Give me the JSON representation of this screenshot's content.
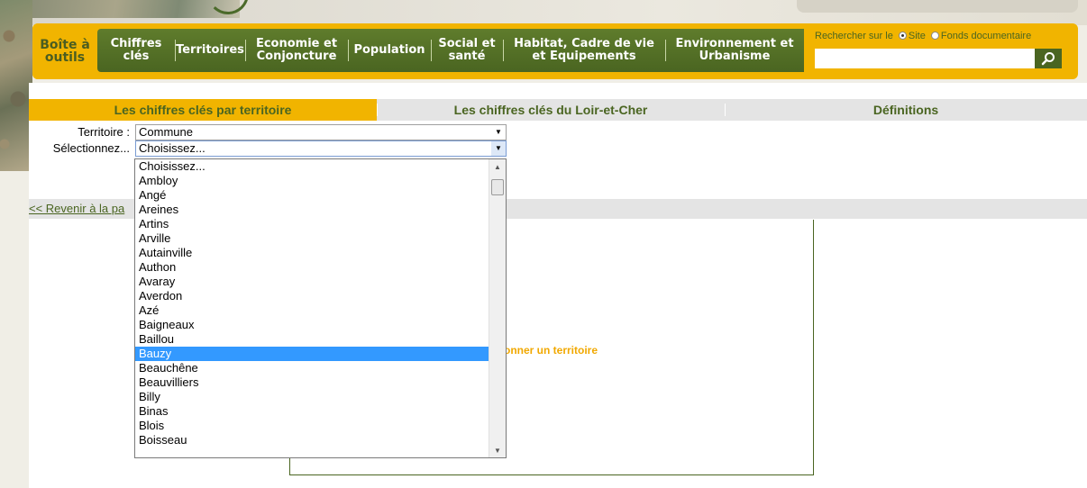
{
  "nav": {
    "home_label": "Boîte à outils",
    "items": [
      {
        "label": "Chiffres clés"
      },
      {
        "label": "Territoires"
      },
      {
        "label": "Economie et Conjoncture"
      },
      {
        "label": "Population"
      },
      {
        "label": "Social et santé"
      },
      {
        "label": "Habitat, Cadre de vie et Equipements"
      },
      {
        "label": "Environnement et Urbanisme"
      }
    ]
  },
  "search": {
    "label_prefix": "Rechercher sur le",
    "option_site": "Site",
    "option_fonds": "Fonds documentaire",
    "selected": "Site",
    "value": ""
  },
  "tabs": [
    {
      "label": "Les chiffres clés par territoire",
      "active": true
    },
    {
      "label": "Les chiffres clés du Loir-et-Cher",
      "active": false
    },
    {
      "label": "Définitions",
      "active": false
    }
  ],
  "form": {
    "territoire_label": "Territoire :",
    "territoire_value": "Commune",
    "selection_label": "Sélectionnez...",
    "selection_value": "Choisissez..."
  },
  "back_link": "<< Revenir à la pa",
  "result_message": "ctionner un territoire",
  "dropdown": {
    "options": [
      "Choisissez...",
      "Ambloy",
      "Angé",
      "Areines",
      "Artins",
      "Arville",
      "Autainville",
      "Authon",
      "Avaray",
      "Averdon",
      "Azé",
      "Baigneaux",
      "Baillou",
      "Bauzy",
      "Beauchêne",
      "Beauvilliers",
      "Billy",
      "Binas",
      "Blois",
      "Boisseau"
    ],
    "highlighted": "Bauzy"
  },
  "colors": {
    "accent_yellow": "#f1b400",
    "nav_green": "#4a6521",
    "highlight_blue": "#3399ff"
  }
}
